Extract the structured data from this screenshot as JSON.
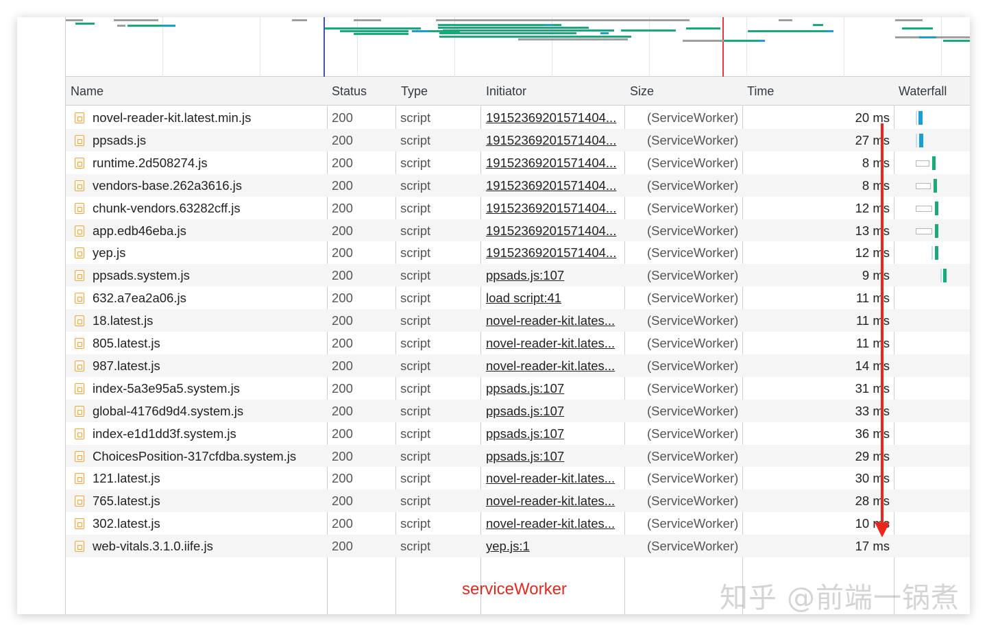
{
  "columns": {
    "name": "Name",
    "status": "Status",
    "type": "Type",
    "initiator": "Initiator",
    "size": "Size",
    "time": "Time",
    "waterfall": "Waterfall"
  },
  "rows": [
    {
      "name": "novel-reader-kit.latest.min.js",
      "status": "200",
      "type": "script",
      "initiator": "19152369201571404...",
      "size": "(ServiceWorker)",
      "time": "20 ms"
    },
    {
      "name": "ppsads.js",
      "status": "200",
      "type": "script",
      "initiator": "19152369201571404...",
      "size": "(ServiceWorker)",
      "time": "27 ms"
    },
    {
      "name": "runtime.2d508274.js",
      "status": "200",
      "type": "script",
      "initiator": "19152369201571404...",
      "size": "(ServiceWorker)",
      "time": "8 ms"
    },
    {
      "name": "vendors-base.262a3616.js",
      "status": "200",
      "type": "script",
      "initiator": "19152369201571404...",
      "size": "(ServiceWorker)",
      "time": "8 ms"
    },
    {
      "name": "chunk-vendors.63282cff.js",
      "status": "200",
      "type": "script",
      "initiator": "19152369201571404...",
      "size": "(ServiceWorker)",
      "time": "12 ms"
    },
    {
      "name": "app.edb46eba.js",
      "status": "200",
      "type": "script",
      "initiator": "19152369201571404...",
      "size": "(ServiceWorker)",
      "time": "13 ms"
    },
    {
      "name": "yep.js",
      "status": "200",
      "type": "script",
      "initiator": "19152369201571404...",
      "size": "(ServiceWorker)",
      "time": "12 ms"
    },
    {
      "name": "ppsads.system.js",
      "status": "200",
      "type": "script",
      "initiator": "ppsads.js:107",
      "size": "(ServiceWorker)",
      "time": "9 ms"
    },
    {
      "name": "632.a7ea2a06.js",
      "status": "200",
      "type": "script",
      "initiator": "load script:41",
      "size": "(ServiceWorker)",
      "time": "11 ms"
    },
    {
      "name": "18.latest.js",
      "status": "200",
      "type": "script",
      "initiator": "novel-reader-kit.lates...",
      "size": "(ServiceWorker)",
      "time": "11 ms"
    },
    {
      "name": "805.latest.js",
      "status": "200",
      "type": "script",
      "initiator": "novel-reader-kit.lates...",
      "size": "(ServiceWorker)",
      "time": "11 ms"
    },
    {
      "name": "987.latest.js",
      "status": "200",
      "type": "script",
      "initiator": "novel-reader-kit.lates...",
      "size": "(ServiceWorker)",
      "time": "14 ms"
    },
    {
      "name": "index-5a3e95a5.system.js",
      "status": "200",
      "type": "script",
      "initiator": "ppsads.js:107",
      "size": "(ServiceWorker)",
      "time": "31 ms"
    },
    {
      "name": "global-4176d9d4.system.js",
      "status": "200",
      "type": "script",
      "initiator": "ppsads.js:107",
      "size": "(ServiceWorker)",
      "time": "33 ms"
    },
    {
      "name": "index-e1d1dd3f.system.js",
      "status": "200",
      "type": "script",
      "initiator": "ppsads.js:107",
      "size": "(ServiceWorker)",
      "time": "36 ms"
    },
    {
      "name": "ChoicesPosition-317cfdba.system.js",
      "status": "200",
      "type": "script",
      "initiator": "ppsads.js:107",
      "size": "(ServiceWorker)",
      "time": "29 ms"
    },
    {
      "name": "121.latest.js",
      "status": "200",
      "type": "script",
      "initiator": "novel-reader-kit.lates...",
      "size": "(ServiceWorker)",
      "time": "30 ms"
    },
    {
      "name": "765.latest.js",
      "status": "200",
      "type": "script",
      "initiator": "novel-reader-kit.lates...",
      "size": "(ServiceWorker)",
      "time": "28 ms"
    },
    {
      "name": "302.latest.js",
      "status": "200",
      "type": "script",
      "initiator": "novel-reader-kit.lates...",
      "size": "(ServiceWorker)",
      "time": "10 ms"
    },
    {
      "name": "web-vitals.3.1.0.iife.js",
      "status": "200",
      "type": "script",
      "initiator": "yep.js:1",
      "size": "(ServiceWorker)",
      "time": "17 ms"
    }
  ],
  "annotation": "serviceWorker",
  "watermark": "知乎 @前端一锅煮",
  "colors": {
    "accent_red": "#e8281e",
    "waterfall_blue": "#1a9ed8",
    "waterfall_green": "#1aa87d",
    "header_bg": "#f3f3f3",
    "row_alt_bg": "#f5f5f5"
  }
}
